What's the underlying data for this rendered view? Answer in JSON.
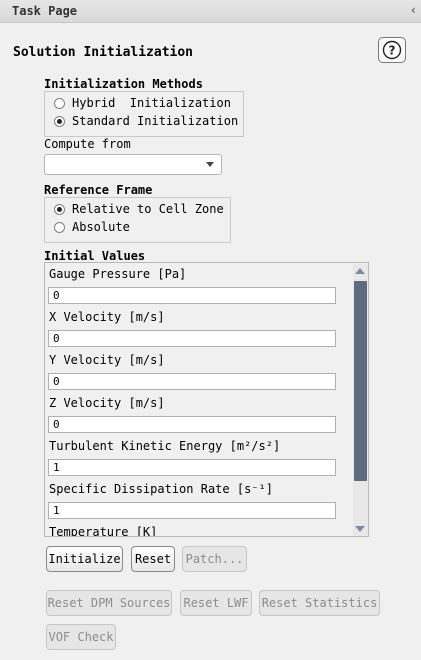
{
  "panel": {
    "title": "Task Page",
    "collapse_glyph": "‹"
  },
  "header": {
    "section_title": "Solution Initialization",
    "help_icon": "question-mark-icon"
  },
  "init_methods": {
    "title": "Initialization Methods",
    "options": [
      {
        "label": "Hybrid  Initialization",
        "selected": false
      },
      {
        "label": "Standard Initialization",
        "selected": true
      }
    ]
  },
  "compute_from": {
    "label": "Compute from",
    "value": ""
  },
  "reference_frame": {
    "title": "Reference Frame",
    "options": [
      {
        "label": "Relative to Cell Zone",
        "selected": true
      },
      {
        "label": "Absolute",
        "selected": false
      }
    ]
  },
  "initial_values": {
    "title": "Initial Values",
    "fields": [
      {
        "label": "Gauge Pressure [Pa]",
        "value": "0"
      },
      {
        "label": "X Velocity [m/s]",
        "value": "0"
      },
      {
        "label": "Y Velocity [m/s]",
        "value": "0"
      },
      {
        "label": "Z Velocity [m/s]",
        "value": "0"
      },
      {
        "label": "Turbulent Kinetic Energy [m²/s²]",
        "value": "1"
      },
      {
        "label": "Specific Dissipation Rate [s⁻¹]",
        "value": "1"
      },
      {
        "label": "Temperature [K]"
      }
    ]
  },
  "buttons": {
    "initialize": "Initialize",
    "reset": "Reset",
    "patch": "Patch...",
    "reset_dpm": "Reset DPM Sources",
    "reset_lwf": "Reset LWF",
    "reset_stats": "Reset Statistics",
    "vof_check": "VOF Check"
  },
  "colors": {
    "scroll_thumb": "#5e6a7e",
    "background": "#f0f0f0"
  }
}
